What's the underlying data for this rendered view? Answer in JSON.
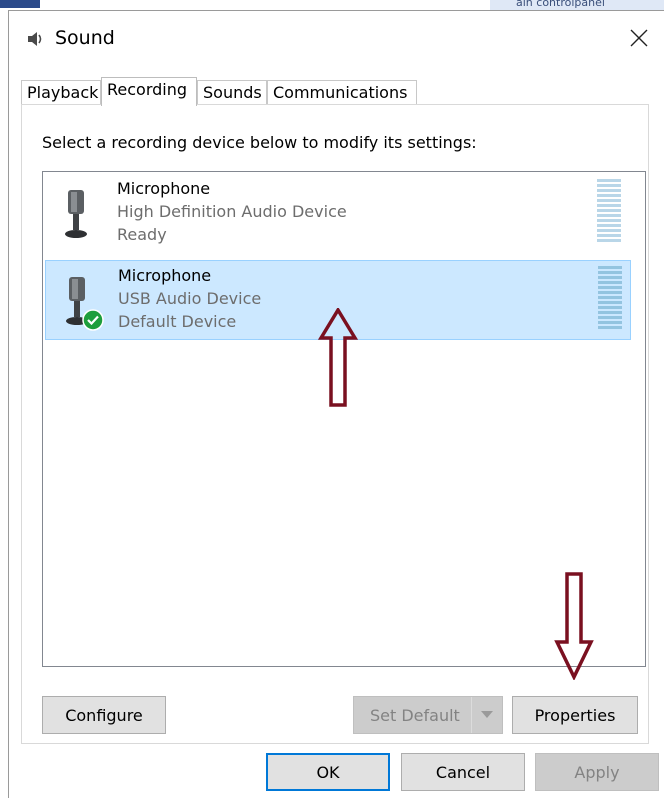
{
  "window": {
    "title": "Sound",
    "background_caption": "ain controlpanel"
  },
  "tabs": [
    {
      "label": "Playback",
      "active": false
    },
    {
      "label": "Recording",
      "active": true
    },
    {
      "label": "Sounds",
      "active": false
    },
    {
      "label": "Communications",
      "active": false
    }
  ],
  "instruction": "Select a recording device below to modify its settings:",
  "devices": [
    {
      "name": "Microphone",
      "description": "High Definition Audio Device",
      "status": "Ready",
      "selected": false,
      "is_default": false
    },
    {
      "name": "Microphone",
      "description": "USB Audio Device",
      "status": "Default Device",
      "selected": true,
      "is_default": true
    }
  ],
  "panel_buttons": {
    "configure": "Configure",
    "set_default": "Set Default",
    "properties": "Properties"
  },
  "footer_buttons": {
    "ok": "OK",
    "cancel": "Cancel",
    "apply": "Apply"
  },
  "colors": {
    "selection_bg": "#cce8ff",
    "annotation_arrow": "#7a1020",
    "default_check": "#1e9e3c",
    "meter_idle": "#b9d6e8"
  },
  "icons": {
    "title": "speaker-icon",
    "close": "close-icon",
    "device": "microphone-icon",
    "default_badge": "check-badge-icon"
  }
}
